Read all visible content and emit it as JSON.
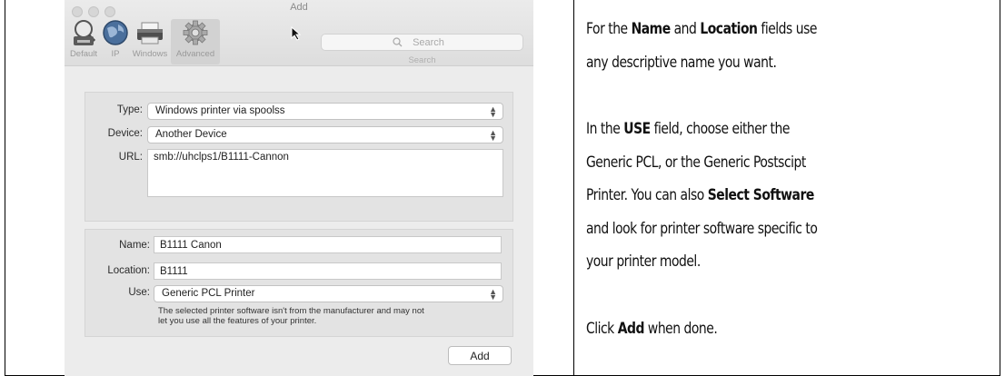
{
  "window": {
    "title": "Add"
  },
  "toolbar": {
    "items": [
      {
        "label": "Default",
        "icon": "default-printer-icon"
      },
      {
        "label": "IP",
        "icon": "ip-globe-icon"
      },
      {
        "label": "Windows",
        "icon": "windows-printer-icon"
      },
      {
        "label": "Advanced",
        "icon": "advanced-gear-icon"
      }
    ],
    "selected": "Advanced"
  },
  "search": {
    "placeholder": "Search",
    "caption": "Search"
  },
  "form": {
    "type_label": "Type:",
    "type_value": "Windows printer via spoolss",
    "device_label": "Device:",
    "device_value": "Another Device",
    "url_label": "URL:",
    "url_value": "smb://uhclps1/B1111-Cannon",
    "name_label": "Name:",
    "name_value": "B1111 Canon",
    "location_label": "Location:",
    "location_value": "B1111",
    "use_label": "Use:",
    "use_value": "Generic PCL Printer",
    "help_line1": "The selected printer software isn't from the manufacturer and may not",
    "help_line2": "let you use all the features of your printer.",
    "add_button": "Add"
  },
  "instructions": {
    "p1_a": "For the ",
    "p1_b": "Name",
    "p1_c": " and ",
    "p1_d": "Location",
    "p1_e": " fields use",
    "p1_line2": "any descriptive name you want.",
    "p2_a": "In the ",
    "p2_b": "USE",
    "p2_c": " field, choose either the",
    "p2_line2": "Generic PCL, or the Generic Postscipt",
    "p2_line3_a": "Printer.  You can also ",
    "p2_line3_b": "Select Software",
    "p2_line4": "and look for printer software specific to",
    "p2_line5": "your printer model.",
    "p3_a": "Click ",
    "p3_b": "Add",
    "p3_c": " when done."
  },
  "colors": {
    "window_bg": "#ececec",
    "panel_bg": "#e3e3e3",
    "text": "#111111"
  }
}
